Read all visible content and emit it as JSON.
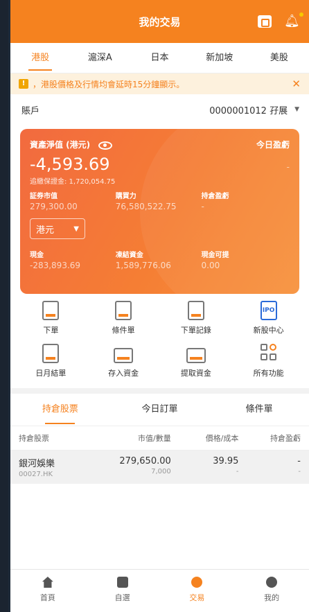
{
  "header": {
    "title": "我的交易"
  },
  "market_tabs": [
    "港股",
    "滬深A",
    "日本",
    "新加坡",
    "美股"
  ],
  "notice": {
    "badge": "!",
    "text": "，港股價格及行情均會延時15分鐘顯示。",
    "close": "✕"
  },
  "account": {
    "label": "賬戶",
    "value": "0000001012 孖展"
  },
  "summary": {
    "nav_label": "資產淨值 (港元)",
    "today_pl_label": "今日盈虧",
    "nav_value": "-4,593.69",
    "today_pl_value": "-",
    "margin_call": "追繳保證金: 1,720,054.75",
    "stock_mv_label": "証券市值",
    "stock_mv_value": "279,300.00",
    "buying_power_label": "購買力",
    "buying_power_value": "76,580,522.75",
    "position_pl_label": "持倉盈虧",
    "position_pl_value": "-",
    "currency": "港元",
    "cash_label": "現金",
    "cash_value": "-283,893.69",
    "frozen_label": "凍結資金",
    "frozen_value": "1,589,776.06",
    "withdrawable_label": "現金可提",
    "withdrawable_value": "0.00"
  },
  "functions": [
    {
      "label": "下單",
      "icon": "order-icon"
    },
    {
      "label": "條件單",
      "icon": "conditional-order-icon"
    },
    {
      "label": "下單記錄",
      "icon": "order-history-icon"
    },
    {
      "label": "新股中心",
      "icon": "ipo-icon",
      "icon_text": "IPO"
    },
    {
      "label": "日月結單",
      "icon": "statement-icon"
    },
    {
      "label": "存入資金",
      "icon": "deposit-icon"
    },
    {
      "label": "提取資金",
      "icon": "withdraw-icon"
    },
    {
      "label": "所有功能",
      "icon": "all-functions-icon"
    }
  ],
  "position_tabs": [
    "持倉股票",
    "今日訂單",
    "條件單"
  ],
  "table": {
    "headers": [
      "持倉股票",
      "市值/數量",
      "價格/成本",
      "持倉盈虧"
    ],
    "rows": [
      {
        "name": "銀河娛樂",
        "code": "00027.HK",
        "market_value": "279,650.00",
        "qty": "7,000",
        "price": "39.95",
        "cost": "-",
        "pl": "-",
        "pl2": "-"
      }
    ]
  },
  "tabbar": [
    {
      "label": "首頁",
      "icon": "home-icon"
    },
    {
      "label": "自選",
      "icon": "watchlist-icon"
    },
    {
      "label": "交易",
      "icon": "trade-icon"
    },
    {
      "label": "我的",
      "icon": "profile-icon"
    }
  ],
  "colors": {
    "accent": "#f5821f",
    "card": "#f26a3f",
    "ipo": "#2a6ad8"
  }
}
